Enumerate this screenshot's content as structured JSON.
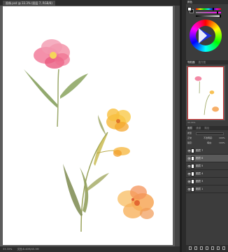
{
  "document": {
    "tab_title": "图像.psd @ 33.3% (图层 7, RGB/8)"
  },
  "status_bar": {
    "zoom": "33.33%",
    "info": "文档:8.40M/45.3M"
  },
  "panels": {
    "color": {
      "tabs": [
        "颜色"
      ],
      "fg_color": "#ffffff",
      "bg_color": "#111111",
      "wheel_hue": "#1c2fd6"
    },
    "navigator": {
      "tabs": [
        "导航器",
        "直方图"
      ],
      "zoom": "33.33%"
    },
    "layers": {
      "tabs": [
        "图层",
        "通道",
        "路径"
      ],
      "kind_label": "类型",
      "blend_mode": "正常",
      "opacity_label": "不透明度:",
      "opacity": "100%",
      "lock_label": "锁定:",
      "fill_label": "填充:",
      "fill": "100%",
      "items": [
        {
          "name": "图层 7",
          "selected": false
        },
        {
          "name": "图层 6",
          "selected": true
        },
        {
          "name": "图层 5",
          "selected": false
        },
        {
          "name": "图层 4",
          "selected": false
        },
        {
          "name": "图层 3",
          "selected": false
        },
        {
          "name": "图层 1",
          "selected": false
        }
      ]
    }
  }
}
